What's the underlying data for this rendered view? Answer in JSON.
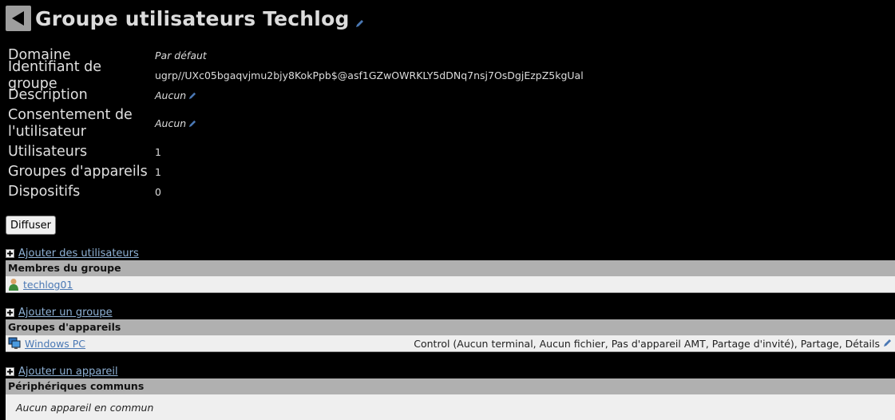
{
  "header": {
    "title": "Groupe utilisateurs Techlog"
  },
  "info": {
    "rows": [
      {
        "label": "Domaine",
        "value": "Par défaut"
      },
      {
        "label": "Identifiant de groupe",
        "value": "ugrp//UXc05bgaqvjmu2bjy8KokPpb$@asf1GZwOWRKLY5dDNq7nsj7OsDgjEzpZ5kgUal"
      },
      {
        "label": "Description",
        "value": "Aucun"
      },
      {
        "label": "Consentement de l'utilisateur",
        "value": "Aucun"
      },
      {
        "label": "Utilisateurs",
        "value": "1"
      },
      {
        "label": "Groupes d'appareils",
        "value": "1"
      },
      {
        "label": "Dispositifs",
        "value": "0"
      }
    ]
  },
  "actions": {
    "broadcast_label": "Diffuser"
  },
  "members": {
    "add_label": "Ajouter des utilisateurs",
    "header": "Membres du groupe",
    "items": [
      {
        "name": "techlog01"
      }
    ]
  },
  "device_groups": {
    "add_label": "Ajouter un groupe",
    "header": "Groupes d'appareils",
    "items": [
      {
        "name": "Windows PC",
        "rights": "Control (Aucun terminal, Aucun fichier, Pas d'appareil AMT, Partage d'invité), Partage, Détails"
      }
    ]
  },
  "common_devices": {
    "add_label": "Ajouter un appareil",
    "header": "Périphériques communs",
    "empty": "Aucun appareil en commun"
  },
  "colors": {
    "background": "#000000",
    "link": "#8fb2d6",
    "section_header": "#b0b0b0",
    "row_bg": "#efefef"
  }
}
